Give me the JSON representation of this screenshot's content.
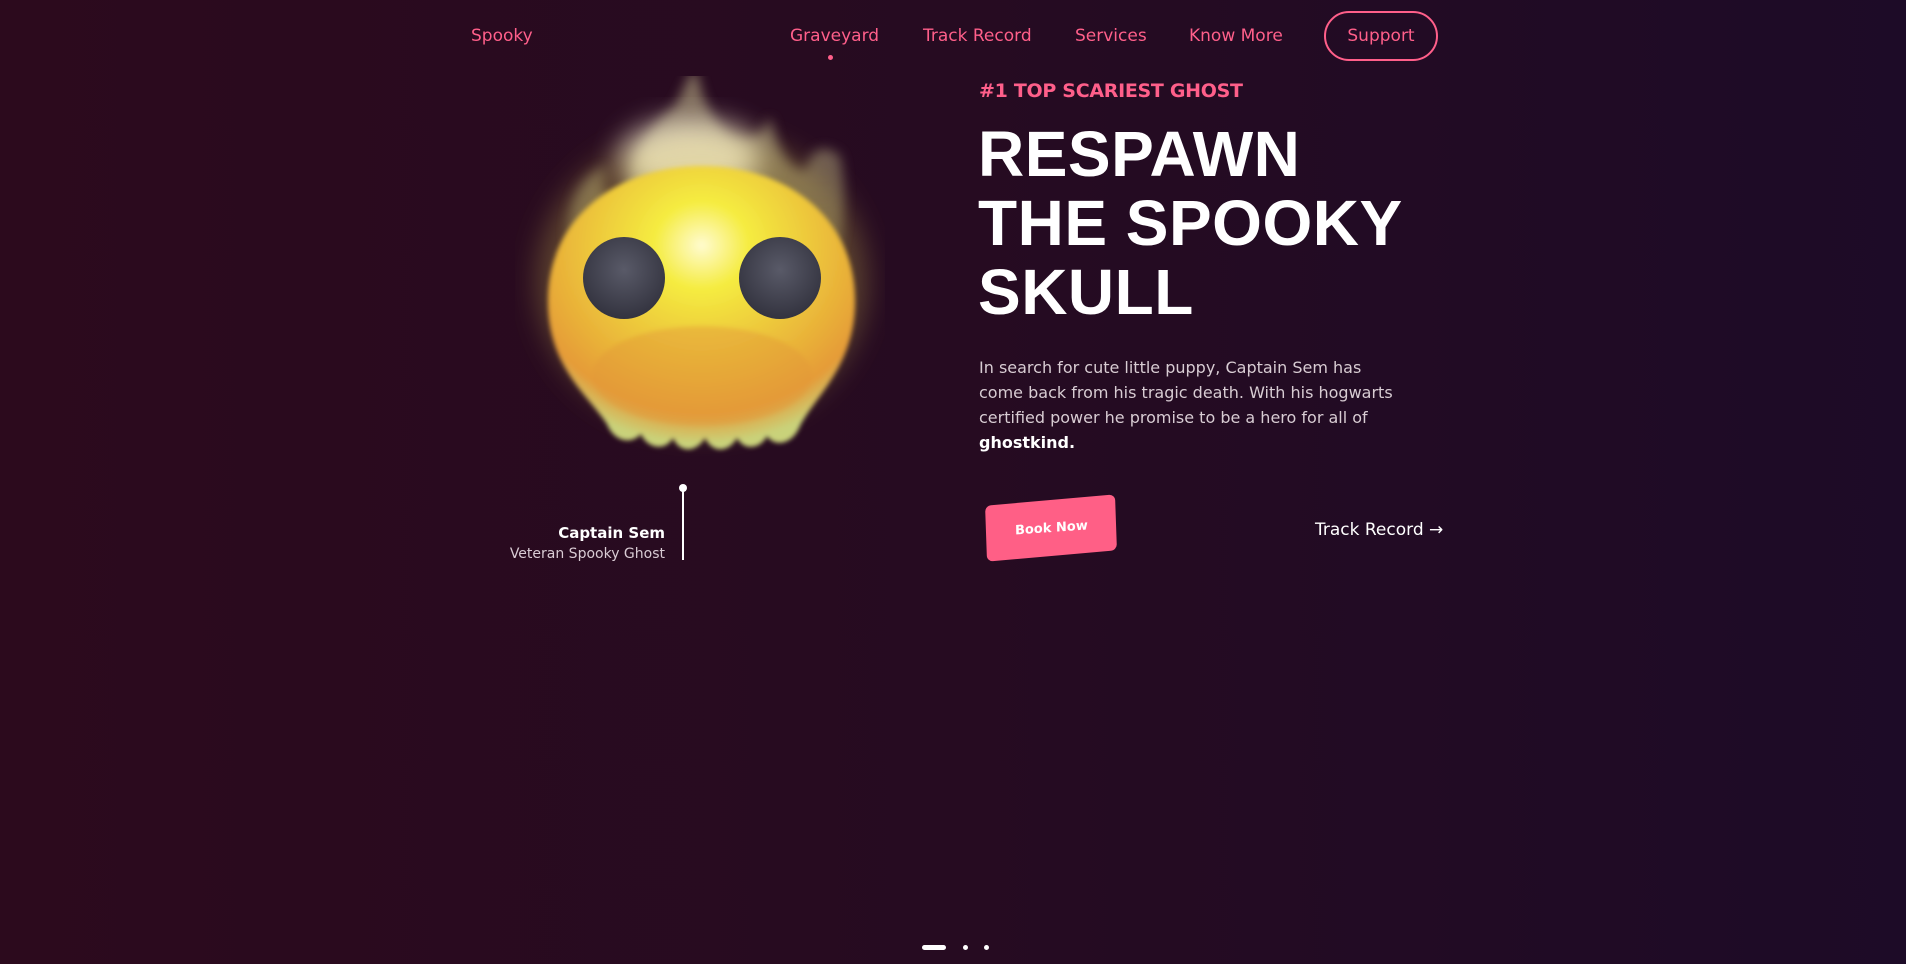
{
  "nav": {
    "brand": "Spooky",
    "links": [
      {
        "label": "Graveyard",
        "active": true
      },
      {
        "label": "Track Record",
        "active": false
      },
      {
        "label": "Services",
        "active": false
      },
      {
        "label": "Know More",
        "active": false
      }
    ],
    "support_label": "Support"
  },
  "hero": {
    "eyebrow": "#1 TOP SCARIEST GHOST",
    "headline": [
      "RESPAWN",
      "THE SPOOKY",
      "SKULL"
    ],
    "description_text": "In search for cute little puppy, Captain Sem has come back from his tragic death. With his hogwarts certified power he promise to be a hero for all of ",
    "description_emphasis": "ghostkind.",
    "book_label": "Book Now",
    "track_label": "Track Record →"
  },
  "character": {
    "name": "Captain Sem",
    "role": "Veteran Spooky Ghost",
    "image_icon": "skull-icon"
  },
  "pager": {
    "total": 3,
    "active": 1
  },
  "colors": {
    "accent": "#ff5f8a",
    "background_left": "#2c0a1d",
    "background_right": "#1d0b27",
    "skull_yellow": "#f2e63f",
    "skull_orange": "#e8a33a",
    "eye": "#3f4050"
  }
}
